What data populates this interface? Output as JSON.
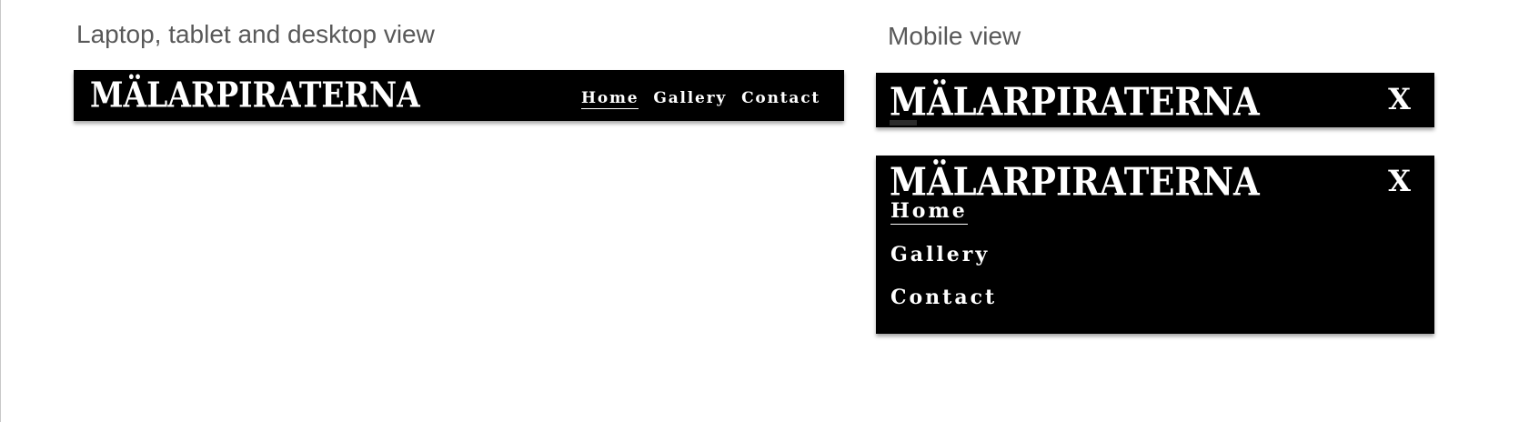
{
  "labels": {
    "desktop": "Laptop, tablet and desktop view",
    "mobile": "Mobile view"
  },
  "brand": "MÄLARPIRATERNA",
  "nav": {
    "home": "Home",
    "gallery": "Gallery",
    "contact": "Contact"
  },
  "toggle": "X",
  "colors": {
    "navbar_bg": "#000000",
    "nav_text": "#ffffff",
    "label_text": "#595959"
  },
  "icons": {
    "menu_toggle": "close-icon"
  }
}
